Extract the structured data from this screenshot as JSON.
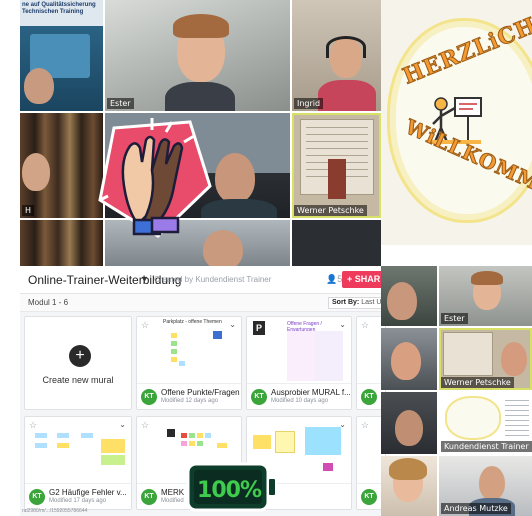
{
  "video_grid": {
    "top_banner": "ne auf Qualitätssicherung Technischen Training",
    "participants": [
      "Ester",
      "Ingrid",
      "Werner Petschke"
    ],
    "partial_label": "H"
  },
  "welcome_card": {
    "line1": "HERZLiCH",
    "line2": "WiLLKOMMEN"
  },
  "mural": {
    "workspace_title": "Online-Trainer-Weiterbildung",
    "created_by": "Created by Kundendienst Trainer",
    "people_count": "5",
    "share_label": "SHAR",
    "section": "Modul 1 - 6",
    "sort_label": "Sort By:",
    "sort_value": "Last Upd",
    "create_label": "Create new mural",
    "avatar_initials": "KT",
    "cards": [
      {
        "name": "Offene Punkte/Fragen",
        "modified": "Modified 12 days ago",
        "thumb_title": "Parkplatz - offene Themen"
      },
      {
        "name": "Ausprobier MURAL f...",
        "modified": "Modified 10 days ago",
        "thumb_title": "Offene Fragen / Erwartungen"
      },
      {
        "name": "G2 Häufige Fehler v...",
        "modified": "Modified 17 days ago"
      },
      {
        "name": "MERK",
        "modified": "Modified"
      }
    ],
    "status_url": "ral2980/m/.../1592055786644"
  },
  "right_gallery": {
    "participants": [
      "Ester",
      "Werner Petschke",
      "Kundendienst Trainer",
      "Andreas Mutzke"
    ]
  },
  "battery": {
    "level_text": "100%",
    "level_fraction": 1.0
  },
  "colors": {
    "share": "#ee3a5b",
    "avatar": "#3ba53b",
    "battery": "#3ecb4e",
    "active_speaker": "#d8e067",
    "hifive_bg": "#e94b6b"
  },
  "icons": [
    "high-five-icon",
    "battery-icon",
    "plus-icon",
    "star-icon",
    "chevron-down-icon",
    "people-icon"
  ]
}
